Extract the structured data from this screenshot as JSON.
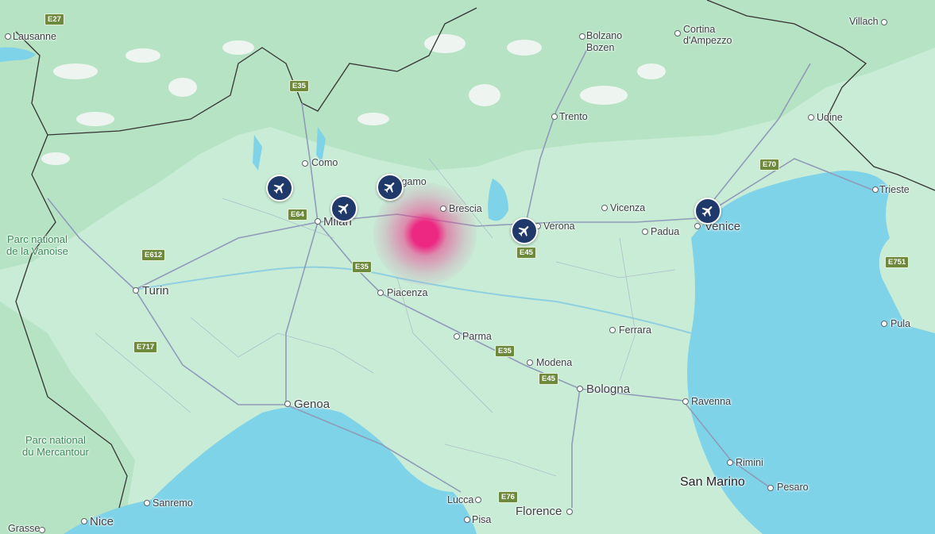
{
  "map": {
    "cities": [
      {
        "id": "lausanne",
        "name": "Lausanne"
      },
      {
        "id": "bolzano",
        "name": "Bolzano"
      },
      {
        "id": "bozen",
        "name": "Bozen"
      },
      {
        "id": "cortina",
        "name": "Cortina"
      },
      {
        "id": "cortina2",
        "name": "d'Ampezzo"
      },
      {
        "id": "villach",
        "name": "Villach"
      },
      {
        "id": "trento",
        "name": "Trento"
      },
      {
        "id": "udine",
        "name": "Udine"
      },
      {
        "id": "como",
        "name": "Como"
      },
      {
        "id": "bergamo",
        "name": "Bergamo"
      },
      {
        "id": "brescia",
        "name": "Brescia"
      },
      {
        "id": "trieste",
        "name": "Trieste"
      },
      {
        "id": "milan",
        "name": "Milan"
      },
      {
        "id": "verona",
        "name": "Verona"
      },
      {
        "id": "vicenza",
        "name": "Vicenza"
      },
      {
        "id": "padua",
        "name": "Padua"
      },
      {
        "id": "venice",
        "name": "Venice"
      },
      {
        "id": "turin",
        "name": "Turin"
      },
      {
        "id": "piacenza",
        "name": "Piacenza"
      },
      {
        "id": "ferrara",
        "name": "Ferrara"
      },
      {
        "id": "pula",
        "name": "Pula"
      },
      {
        "id": "parma",
        "name": "Parma"
      },
      {
        "id": "modena",
        "name": "Modena"
      },
      {
        "id": "bologna",
        "name": "Bologna"
      },
      {
        "id": "genoa",
        "name": "Genoa"
      },
      {
        "id": "ravenna",
        "name": "Ravenna"
      },
      {
        "id": "rimini",
        "name": "Rimini"
      },
      {
        "id": "sanmarino",
        "name": "San Marino"
      },
      {
        "id": "pesaro",
        "name": "Pesaro"
      },
      {
        "id": "lucca",
        "name": "Lucca"
      },
      {
        "id": "florence",
        "name": "Florence"
      },
      {
        "id": "pisa",
        "name": "Pisa"
      },
      {
        "id": "sanremo",
        "name": "Sanremo"
      },
      {
        "id": "nice",
        "name": "Nice"
      },
      {
        "id": "grasse",
        "name": "Grasse"
      }
    ],
    "parks": [
      {
        "id": "vanoise",
        "line1": "Parc national",
        "line2": "de la Vanoise"
      },
      {
        "id": "mercantour",
        "line1": "Parc national",
        "line2": "du Mercantour"
      }
    ],
    "roads": [
      "E27",
      "E35",
      "E64",
      "E612",
      "E35",
      "E717",
      "E70",
      "E45",
      "E35",
      "E45",
      "E751",
      "E76"
    ],
    "airport_icon": "airplane-icon",
    "colors": {
      "land": "#c8ecd6",
      "water": "#7fd3e8",
      "heat": "#ec2882",
      "airport": "#1f3a6a"
    }
  }
}
